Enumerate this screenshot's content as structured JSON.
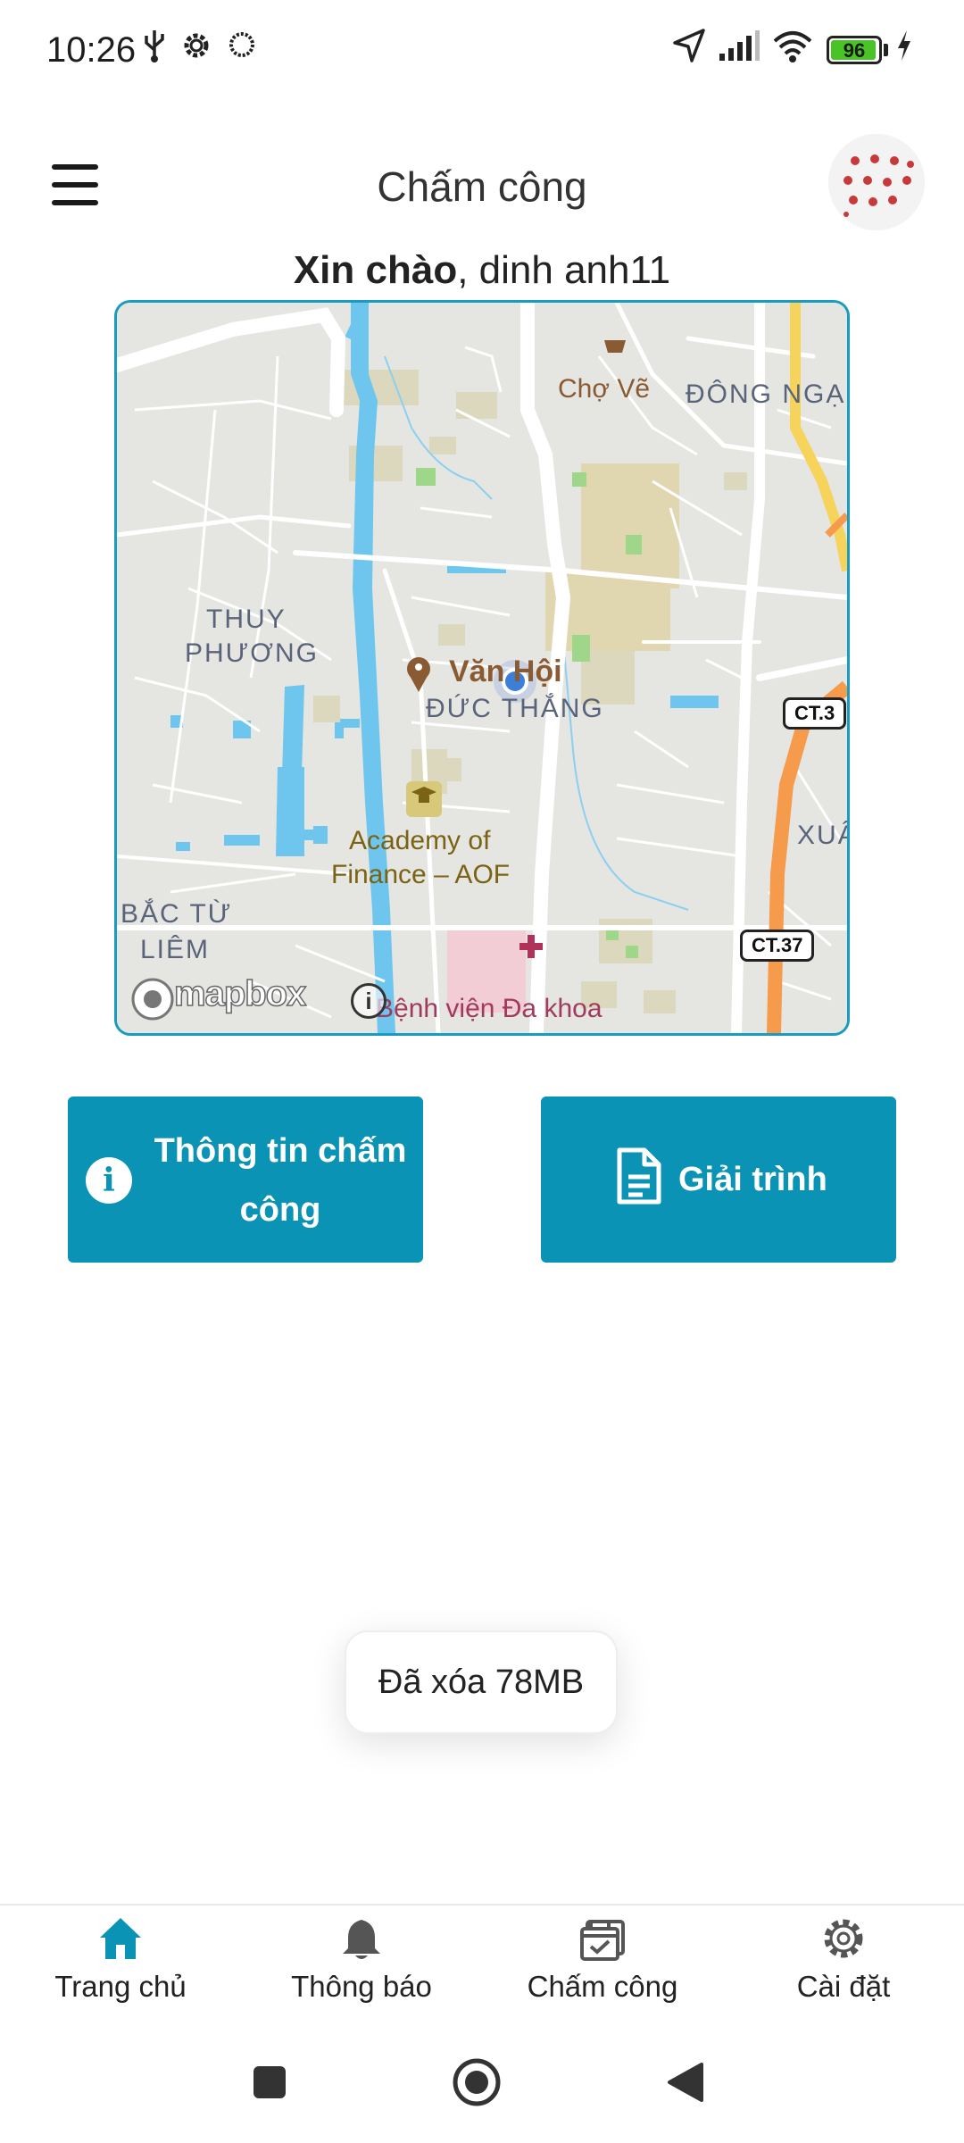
{
  "status_bar": {
    "time": "10:26",
    "battery": "96",
    "battery_level": 0.96
  },
  "app_bar": {
    "title": "Chấm công"
  },
  "greeting": {
    "bold": "Xin chào",
    "rest": ", dinh anh11"
  },
  "map": {
    "labels": {
      "cho_ve": "Chợ Vẽ",
      "dong_nga": "ĐÔNG NGẠ",
      "thuy": "THUY",
      "phuong": "PHƯƠNG",
      "van_hoi": "Văn Hội",
      "duc_thang": "ĐỨC THẮNG",
      "academy_1": "Academy of",
      "academy_2": "Finance – AOF",
      "bac_tu": "BẮC TỪ",
      "liem": "LIÊM",
      "xua": "XUÂ",
      "hospital": "Bệnh viện Đa khoa",
      "ct3": "CT.3",
      "ct37": "CT.37",
      "mapbox": "mapbox"
    }
  },
  "buttons": {
    "info": "Thông tin chấm công",
    "explain": "Giải trình"
  },
  "toast": {
    "text": "Đã xóa 78MB"
  },
  "nav": {
    "home": "Trang chủ",
    "notifications": "Thông báo",
    "timekeeping": "Chấm công",
    "settings": "Cài đặt"
  },
  "colors": {
    "primary": "#0b93b6",
    "map_border": "#1a9bc0",
    "river": "#6ec6ee",
    "highway": "#f69a4b"
  }
}
